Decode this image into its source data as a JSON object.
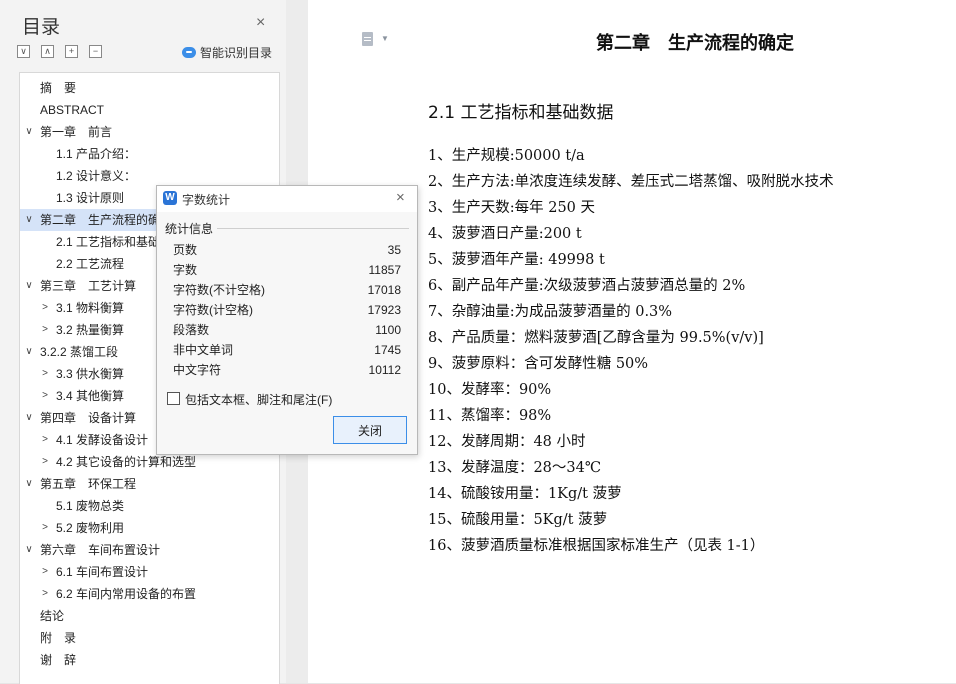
{
  "sidebar": {
    "title": "目录",
    "close": "×",
    "tools": [
      "∨",
      "∧",
      "+",
      "−"
    ],
    "smart_toc": "智能识别目录",
    "items": [
      {
        "label": "摘　要",
        "level": 1,
        "arrow": ""
      },
      {
        "label": "ABSTRACT",
        "level": 1,
        "arrow": ""
      },
      {
        "label": "第一章　前言",
        "level": 1,
        "arrow": "∨"
      },
      {
        "label": "1.1 产品介绍：",
        "level": 2,
        "arrow": ""
      },
      {
        "label": "1.2 设计意义：",
        "level": 2,
        "arrow": ""
      },
      {
        "label": "1.3  设计原则",
        "level": 2,
        "arrow": ""
      },
      {
        "label": "第二章　生产流程的确",
        "level": 1,
        "arrow": "∨",
        "selected": true
      },
      {
        "label": "2.1  工艺指标和基础",
        "level": 2,
        "arrow": ""
      },
      {
        "label": "2.2  工艺流程",
        "level": 2,
        "arrow": ""
      },
      {
        "label": "第三章　工艺计算",
        "level": 1,
        "arrow": "∨"
      },
      {
        "label": "3.1 物料衡算",
        "level": 2,
        "arrow": ">"
      },
      {
        "label": "3.2  热量衡算",
        "level": 2,
        "arrow": ">"
      },
      {
        "label": "3.2.2  蒸馏工段",
        "level": 1,
        "arrow": "∨"
      },
      {
        "label": "3.3  供水衡算",
        "level": 2,
        "arrow": ">"
      },
      {
        "label": "3.4  其他衡算",
        "level": 2,
        "arrow": ">"
      },
      {
        "label": "第四章　设备计算",
        "level": 1,
        "arrow": "∨"
      },
      {
        "label": "4.1 发酵设备设计",
        "level": 2,
        "arrow": ">"
      },
      {
        "label": "4.2 其它设备的计算和选型",
        "level": 2,
        "arrow": ">"
      },
      {
        "label": "第五章　环保工程",
        "level": 1,
        "arrow": "∨"
      },
      {
        "label": "5.1  废物总类",
        "level": 2,
        "arrow": ""
      },
      {
        "label": "5.2  废物利用",
        "level": 2,
        "arrow": ">"
      },
      {
        "label": "第六章　车间布置设计",
        "level": 1,
        "arrow": "∨"
      },
      {
        "label": "6.1 车间布置设计",
        "level": 2,
        "arrow": ">"
      },
      {
        "label": "6.2 车间内常用设备的布置",
        "level": 2,
        "arrow": ">"
      },
      {
        "label": "结论",
        "level": 1,
        "arrow": ""
      },
      {
        "label": "附　录",
        "level": 1,
        "arrow": ""
      },
      {
        "label": "谢　辞",
        "level": 1,
        "arrow": ""
      }
    ]
  },
  "document": {
    "chapter_title": "第二章　生产流程的确定",
    "section_title": "2.1  工艺指标和基础数据",
    "lines": [
      "1、生产规模:50000 t/a",
      "2、生产方法:单浓度连续发酵、差压式二塔蒸馏、吸附脱水技术",
      "3、生产天数:每年 250 天",
      "4、菠萝酒日产量:200 t",
      "5、菠萝酒年产量: 49998 t",
      "6、副产品年产量:次级菠萝酒占菠萝酒总量的 2%",
      "7、杂醇油量:为成品菠萝酒量的 0.3%",
      "8、产品质量：燃料菠萝酒[乙醇含量为 99.5%(v/v)]",
      "9、菠萝原料：含可发酵性糖 50%",
      "10、发酵率：90%",
      "11、蒸馏率：98%",
      "12、发酵周期：48 小时",
      "13、发酵温度：28～34℃",
      "14、硫酸铵用量：1Kg/t 菠萝",
      "15、硫酸用量：5Kg/t 菠萝",
      "16、菠萝酒质量标准根据国家标准生产（见表 1-1）"
    ]
  },
  "dialog": {
    "logo": "W",
    "title": "字数统计",
    "close": "×",
    "group_label": "统计信息",
    "stats": [
      {
        "label": "页数",
        "value": "35"
      },
      {
        "label": "字数",
        "value": "11857"
      },
      {
        "label": "字符数(不计空格)",
        "value": "17018"
      },
      {
        "label": "字符数(计空格)",
        "value": "17923"
      },
      {
        "label": "段落数",
        "value": "1100"
      },
      {
        "label": "非中文单词",
        "value": "1745"
      },
      {
        "label": "中文字符",
        "value": "10112"
      }
    ],
    "checkbox_label": "包括文本框、脚注和尾注(F)",
    "checkbox_checked": false,
    "close_button": "关闭"
  }
}
